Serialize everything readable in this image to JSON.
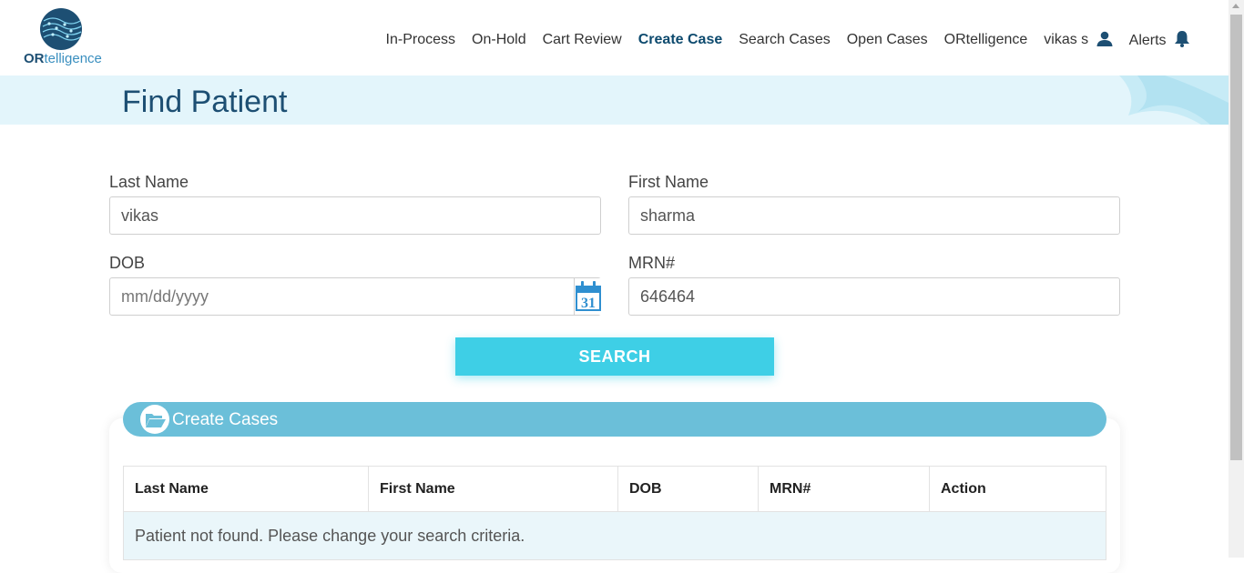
{
  "brand": {
    "logo_bold": "OR",
    "logo_rest": "telligence"
  },
  "nav": {
    "items": [
      "In-Process",
      "On-Hold",
      "Cart Review",
      "Create Case",
      "Search Cases",
      "Open Cases",
      "ORtelligence"
    ],
    "active": "Create Case",
    "user": "vikas s",
    "alerts": "Alerts"
  },
  "page": {
    "title": "Find Patient"
  },
  "form": {
    "last_name": {
      "label": "Last Name",
      "value": "vikas"
    },
    "first_name": {
      "label": "First Name",
      "value": "sharma"
    },
    "dob": {
      "label": "DOB",
      "placeholder": "mm/dd/yyyy",
      "calendar_day": "31"
    },
    "mrn": {
      "label": "MRN#",
      "value": "646464"
    },
    "search_label": "SEARCH"
  },
  "cases": {
    "title": "Create Cases",
    "columns": [
      "Last Name",
      "First Name",
      "DOB",
      "MRN#",
      "Action"
    ],
    "empty_message": "Patient not found. Please change your search criteria."
  },
  "colors": {
    "brand": "#1d4f73",
    "accent": "#3ecfe6",
    "panel_header": "#6bbfd9",
    "band": "#e3f5fb"
  }
}
